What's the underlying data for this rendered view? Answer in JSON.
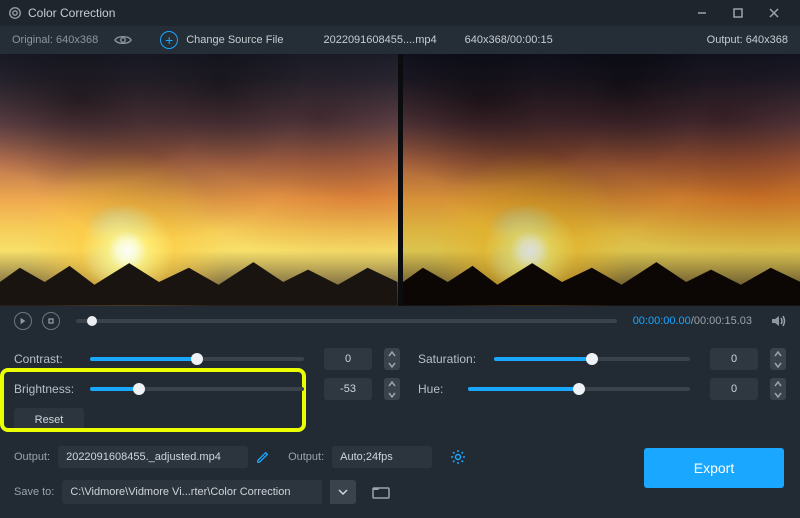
{
  "window": {
    "title": "Color Correction"
  },
  "infobar": {
    "original_label": "Original: 640x368",
    "change_label": "Change Source File",
    "filename": "2022091608455....mp4",
    "meta": "640x368/00:00:15",
    "output_label": "Output: 640x368"
  },
  "player": {
    "current_time": "00:00:00.00",
    "duration": "00:00:15.03"
  },
  "sliders": {
    "contrast": {
      "label": "Contrast:",
      "value": "0",
      "fill_pct": 50,
      "thumb_pct": 50
    },
    "brightness": {
      "label": "Brightness:",
      "value": "-53",
      "fill_pct": 23,
      "thumb_pct": 23
    },
    "saturation": {
      "label": "Saturation:",
      "value": "0",
      "fill_pct": 50,
      "thumb_pct": 50
    },
    "hue": {
      "label": "Hue:",
      "value": "0",
      "fill_pct": 50,
      "thumb_pct": 50
    }
  },
  "buttons": {
    "reset": "Reset",
    "export": "Export"
  },
  "output": {
    "label1": "Output:",
    "filename": "2022091608455._adjusted.mp4",
    "label2": "Output:",
    "format": "Auto;24fps"
  },
  "save": {
    "label": "Save to:",
    "path": "C:\\Vidmore\\Vidmore Vi...rter\\Color Correction"
  }
}
